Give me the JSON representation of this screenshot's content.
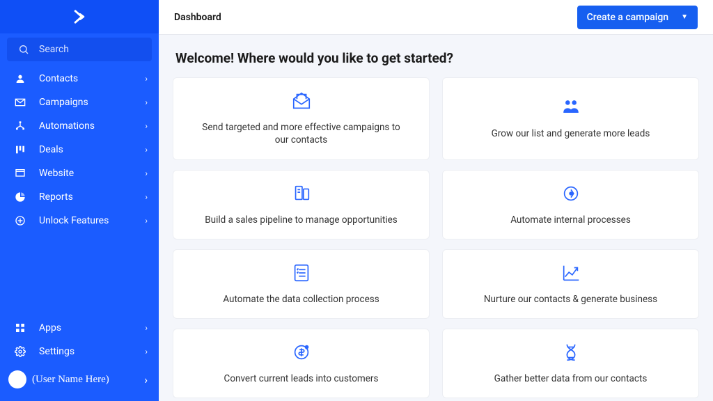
{
  "header": {
    "title": "Dashboard",
    "cta_label": "Create a campaign"
  },
  "sidebar": {
    "search_label": "Search",
    "nav": [
      {
        "label": "Contacts"
      },
      {
        "label": "Campaigns"
      },
      {
        "label": "Automations"
      },
      {
        "label": "Deals"
      },
      {
        "label": "Website"
      },
      {
        "label": "Reports"
      },
      {
        "label": "Unlock Features"
      }
    ],
    "bottom": [
      {
        "label": "Apps"
      },
      {
        "label": "Settings"
      }
    ],
    "user_name": "(User Name Here)"
  },
  "main": {
    "welcome": "Welcome! Where would you like to get started?",
    "cards": [
      {
        "text": "Send targeted and more effective campaigns to our contacts"
      },
      {
        "text": "Grow our list and generate more leads"
      },
      {
        "text": "Build a sales pipeline to manage opportunities"
      },
      {
        "text": "Automate internal processes"
      },
      {
        "text": "Automate the data collection process"
      },
      {
        "text": "Nurture our contacts & generate business"
      },
      {
        "text": "Convert current leads into customers"
      },
      {
        "text": "Gather better data from our contacts"
      }
    ]
  }
}
